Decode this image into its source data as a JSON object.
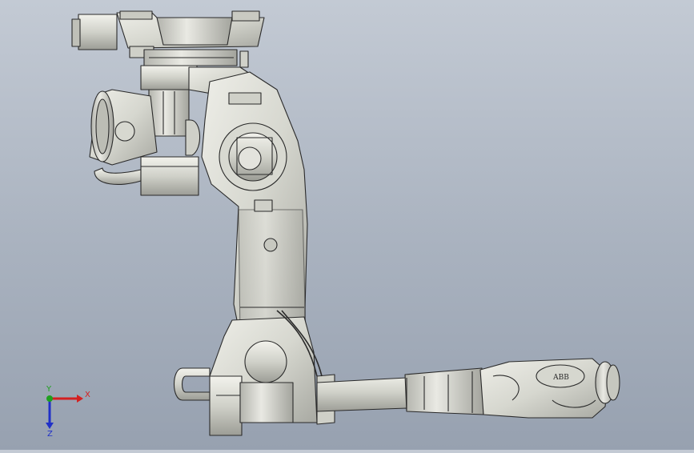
{
  "viewport": {
    "model_subject": "industrial-robot-arm",
    "background_top": "#c3cad4",
    "background_bottom": "#97a1b0",
    "model_fill": "#d9dad2",
    "model_edge": "#2a2a2a"
  },
  "triad": {
    "x_label": "X",
    "y_label": "Y",
    "z_label": "Z",
    "x_color": "#d42020",
    "y_color": "#1fa01f",
    "z_color": "#2030c8"
  },
  "logo_text": "ABB"
}
